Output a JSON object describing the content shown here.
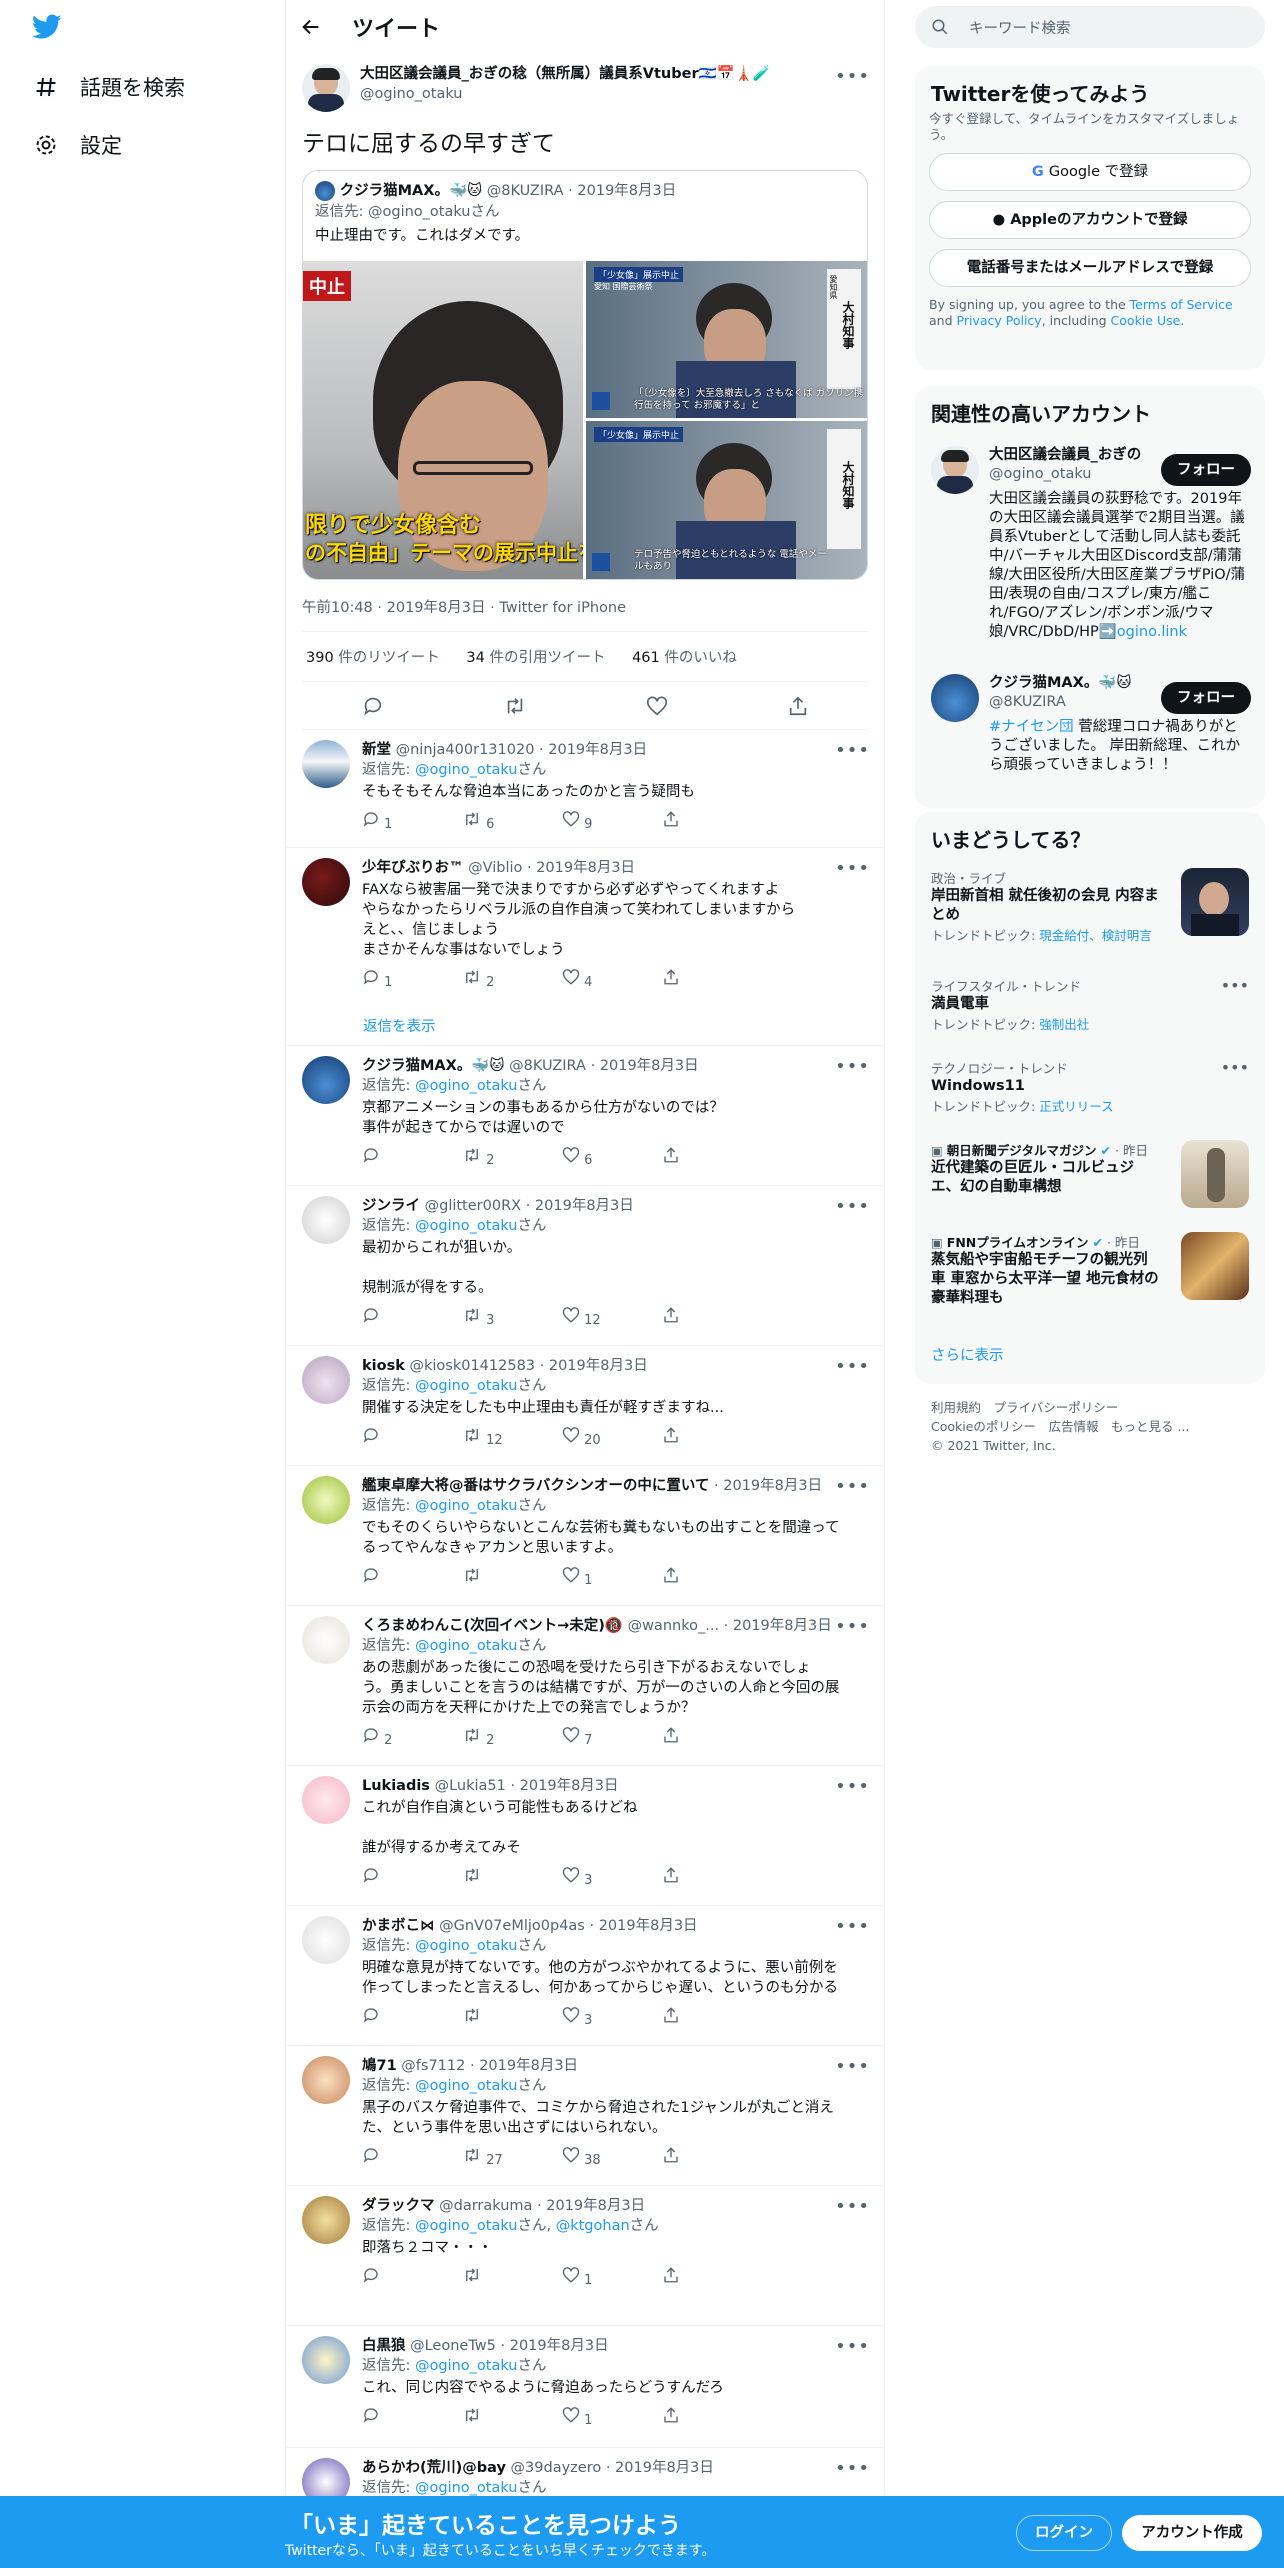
{
  "nav": {
    "explore": "話題を検索",
    "settings": "設定"
  },
  "header": {
    "title": "ツイート"
  },
  "tweet": {
    "name": "大田区議会議員_おぎの稔（無所属）議員系Vtuber🇮🇱📅🗼🧪",
    "handle": "@ogino_otaku",
    "text": "テロに屈するの早すぎて",
    "quote": {
      "name": "クジラ猫MAX。🐳🐱",
      "handle": "@8KUZIRA",
      "date": "2019年8月3日",
      "reply_to_prefix": "返信先: ",
      "reply_to": "@ogino_otakuさん",
      "text": "中止理由です。これはダメです。"
    },
    "media": {
      "big_caption1": "限りで少女像含む",
      "big_caption2": "の不自由」テーマの展示中止を",
      "label_left": "中止",
      "news_header": "「少女像」展示中止",
      "news_sub": "愛知 国際芸術祭",
      "vert_name": "大村知事",
      "vert_role": "愛知県",
      "cap_top": "「〔少女像を〕大至急撤去しろ さもなくば ガソリン携行缶を持って お邪魔する」と",
      "cap_bottom": "テロ予告や脅迫ともとれるような 電話やメールもあり"
    },
    "meta": "午前10:48 · 2019年8月3日 · Twitter for iPhone",
    "stats": {
      "retweets": "390",
      "retweets_label": "件のリツイート",
      "quotes": "34",
      "quotes_label": "件の引用ツイート",
      "likes": "461",
      "likes_label": "件のいいね"
    }
  },
  "reply_prefix": "返信先: ",
  "reply_suffix": "さん",
  "replies": [
    {
      "name": "新堂",
      "handle": "@ninja400r131020",
      "date": "2019年8月3日",
      "reply_to": "@ogino_otaku",
      "text": "そもそもそんな脅迫本当にあったのかと言う疑問も",
      "replies": "1",
      "retweets": "6",
      "likes": "9"
    },
    {
      "name": "少年ぴぶりお™",
      "handle": "@Viblio",
      "date": "2019年8月3日",
      "reply_to": "",
      "text": "FAXなら被害届一発で決まりですから必ず必ずやってくれますよ\nやらなかったらリベラル派の自作自演って笑われてしまいますから\nえと、、信じましょう\nまさかそんな事はないでしょう",
      "replies": "1",
      "retweets": "2",
      "likes": "4"
    },
    {
      "name": "クジラ猫MAX。🐳🐱",
      "handle": "@8KUZIRA",
      "date": "2019年8月3日",
      "reply_to": "@ogino_otaku",
      "text": "京都アニメーションの事もあるから仕方がないのでは？\n事件が起きてからでは遅いので",
      "replies": "",
      "retweets": "2",
      "likes": "6"
    },
    {
      "name": "ジンライ",
      "handle": "@glitter00RX",
      "date": "2019年8月3日",
      "reply_to": "@ogino_otaku",
      "text": "最初からこれが狙いか。\n\n規制派が得をする。",
      "replies": "",
      "retweets": "3",
      "likes": "12"
    },
    {
      "name": "kiosk",
      "handle": "@kiosk01412583",
      "date": "2019年8月3日",
      "reply_to": "@ogino_otaku",
      "text": "開催する決定をしたも中止理由も責任が軽すぎますね...",
      "replies": "",
      "retweets": "12",
      "likes": "20"
    },
    {
      "name": "艦東卓摩大将@番はサクラバクシンオーの中に置いて",
      "handle": "",
      "date": "2019年8月3日",
      "reply_to": "@ogino_otaku",
      "text": "でもそのくらいやらないとこんな芸術も糞もないもの出すことを間違って\nるってやんなきゃアカンと思いますよ。",
      "replies": "",
      "retweets": "",
      "likes": "1"
    },
    {
      "name": "くろまめわんこ(次回イベント→未定)🔞",
      "handle": "@wannko_...",
      "date": "2019年8月3日",
      "reply_to": "@ogino_otaku",
      "text": "あの悲劇があった後にこの恐喝を受けたら引き下がるおえないでしょ\nう。勇ましいことを言うのは結構ですが、万が一のさいの人命と今回の展\n示会の両方を天秤にかけた上での発言でしょうか？",
      "replies": "2",
      "retweets": "2",
      "likes": "7"
    },
    {
      "name": "Lukiadis",
      "handle": "@Lukia51",
      "date": "2019年8月3日",
      "reply_to": "",
      "text": "これが自作自演という可能性もあるけどね\n\n誰が得するか考えてみそ",
      "replies": "",
      "retweets": "",
      "likes": "3"
    },
    {
      "name": "かまボこ⋈",
      "handle": "@GnV07eMljo0p4as",
      "date": "2019年8月3日",
      "reply_to": "@ogino_otaku",
      "text": "明確な意見が持てないです。他の方がつぶやかれてるように、悪い前例を\n作ってしまったと言えるし、何かあってからじゃ遅い、というのも分かる",
      "replies": "",
      "retweets": "",
      "likes": "3"
    },
    {
      "name": "鳩71",
      "handle": "@fs7112",
      "date": "2019年8月3日",
      "reply_to": "@ogino_otaku",
      "text": "黒子のバスケ脅迫事件で、コミケから脅迫された1ジャンルが丸ごと消え\nた、という事件を思い出さずにはいられない。",
      "replies": "",
      "retweets": "27",
      "likes": "38"
    },
    {
      "name": "ダラックマ",
      "handle": "@darrakuma",
      "date": "2019年8月3日",
      "reply_to": "@ogino_otaku",
      "reply_to2": "@ktgohan",
      "text": "即落ち２コマ・・・",
      "replies": "",
      "retweets": "",
      "likes": "1"
    },
    {
      "name": "白黒狼",
      "handle": "@LeoneTw5",
      "date": "2019年8月3日",
      "reply_to": "@ogino_otaku",
      "text": "これ、同じ内容でやるように脅迫あったらどうすんだろ",
      "replies": "",
      "retweets": "",
      "likes": "1"
    },
    {
      "name": "あらかわ(荒川)@bay",
      "handle": "@39dayzero",
      "date": "2019年8月3日",
      "reply_to": "@ogino_otaku",
      "text": "",
      "replies": "",
      "retweets": "",
      "likes": ""
    }
  ],
  "show_replies": "返信を表示",
  "right": {
    "search_placeholder": "キーワード検索",
    "try": {
      "title": "Twitterを使ってみよう",
      "desc": "今すぐ登録して、タイムラインをカスタマイズしましょう。",
      "google": "Google で登録",
      "apple": "Appleのアカウントで登録",
      "phone": "電話番号またはメールアドレスで登録",
      "terms1": "By signing up, you agree to the ",
      "tos": "Terms of Service",
      "terms2": " and ",
      "privacy": "Privacy Policy",
      "terms3": ", including ",
      "cookie": "Cookie Use",
      "terms4": "."
    },
    "relevant": {
      "title": "関連性の高いアカウント",
      "follow": "フォロー",
      "accounts": [
        {
          "name": "大田区議会議員_おぎの",
          "handle": "@ogino_otaku",
          "bio": "大田区議会議員の荻野稔です。2019年の大田区議会議員選挙で2期目当選。議員系Vtuberとして活動し同人誌も委託中/バーチャル大田区Discord支部/蒲蒲線/大田区役所/大田区産業プラザPiO/蒲田/表現の自由/コスプレ/東方/艦これ/FGO/アズレン/ボンボン派/ウマ娘/VRC/DbD/HP➡️",
          "link": "ogino.link"
        },
        {
          "name": "クジラ猫MAX。🐳🐱",
          "handle": "@8KUZIRA",
          "bio_tag": "#ナイセン団",
          "bio": " 菅総理コロナ禍ありがとうございました。 岸田新総理、これから頑張っていきましょう！！"
        }
      ]
    },
    "trends": {
      "title": "いまどうしてる？",
      "more": "さらに表示",
      "items": [
        {
          "cat": "政治・ライブ",
          "t": "岸田新首相 就任後初の会見 内容まとめ",
          "sub_prefix": "トレンドトピック: ",
          "sub": "現金給付、検討明言"
        },
        {
          "cat": "ライフスタイル・トレンド",
          "t": "満員電車",
          "sub_prefix": "トレンドトピック: ",
          "sub": "強制出社"
        },
        {
          "cat": "テクノロジー・トレンド",
          "t": "Windows11",
          "sub_prefix": "トレンドトピック: ",
          "sub": "正式リリース"
        },
        {
          "cat": "朝日新聞デジタルマガジン",
          "date": "· 昨日",
          "t": "近代建築の巨匠ル・コルビュジエ、幻の自動車構想"
        },
        {
          "cat": "FNNプライムオンライン",
          "date": "· 昨日",
          "t": "蒸気船や宇宙船モチーフの観光列車 車窓から太平洋一望 地元食材の豪華料理も"
        }
      ]
    },
    "footer": {
      "l1a": "利用規約",
      "l1b": "プライバシーポリシー",
      "l2a": "Cookieのポリシー",
      "l2b": "広告情報",
      "l2c": "もっと見る ...",
      "copy": "© 2021 Twitter, Inc."
    }
  },
  "bottom": {
    "title": "「いま」起きていることを見つけよう",
    "sub": "Twitterなら、「いま」起きていることをいち早くチェックできます。",
    "login": "ログイン",
    "signup": "アカウント作成"
  },
  "colors": {
    "brand": "#1d9bf0",
    "text": "#0f1419",
    "muted": "#536471"
  }
}
